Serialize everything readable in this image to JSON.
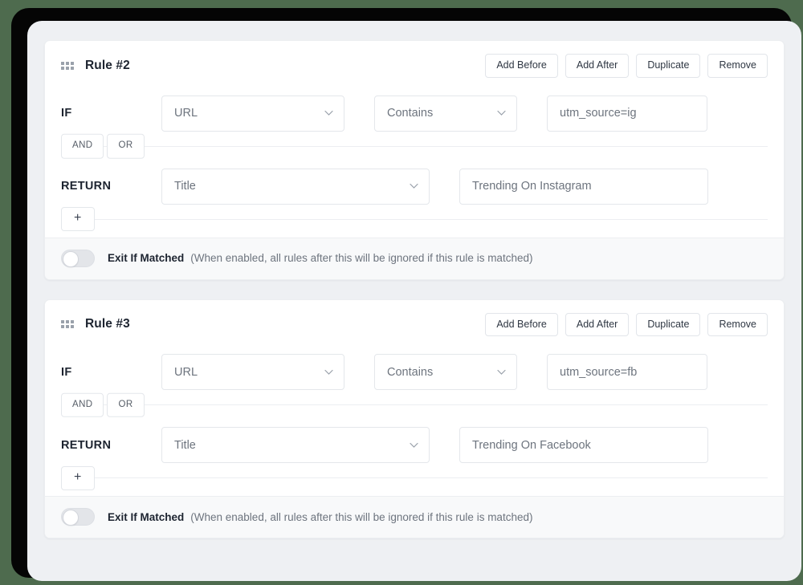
{
  "colors": {
    "outer_background": "#4e6b4e",
    "frame": "#050505",
    "page_background": "#eef0f3",
    "card_background": "#ffffff",
    "border": "#e4e7eb",
    "text_primary": "#1d2430",
    "text_muted": "#6d747e",
    "footer_background": "#f8f9fa",
    "toggle_track_off": "#e3e5e9"
  },
  "icons": {
    "drag_handle": "drag-handle-icon",
    "chevron_down": "chevron-down-icon",
    "plus": "plus-icon"
  },
  "header_actions": [
    {
      "label": "Add Before",
      "name": "add-before-button"
    },
    {
      "label": "Add After",
      "name": "add-after-button"
    },
    {
      "label": "Duplicate",
      "name": "duplicate-button"
    },
    {
      "label": "Remove",
      "name": "remove-button"
    }
  ],
  "labels": {
    "if": "IF",
    "return": "RETURN",
    "and": "AND",
    "or": "OR",
    "plus": "+",
    "exit_if_matched": "Exit If Matched",
    "exit_if_matched_hint": "(When enabled, all rules after this will be ignored if this rule is matched)"
  },
  "rules": [
    {
      "title": "Rule #2",
      "condition": {
        "subject": "URL",
        "operator": "Contains",
        "value": "utm_source=ig",
        "value_placeholder": "utm_source=ig"
      },
      "return": {
        "key": "Title",
        "value": "Trending On Instagram",
        "value_placeholder": "Trending On Instagram"
      },
      "exit_if_matched": false
    },
    {
      "title": "Rule #3",
      "condition": {
        "subject": "URL",
        "operator": "Contains",
        "value": "utm_source=fb",
        "value_placeholder": "utm_source=fb"
      },
      "return": {
        "key": "Title",
        "value": "Trending On Facebook",
        "value_placeholder": "Trending On Facebook"
      },
      "exit_if_matched": false
    }
  ]
}
